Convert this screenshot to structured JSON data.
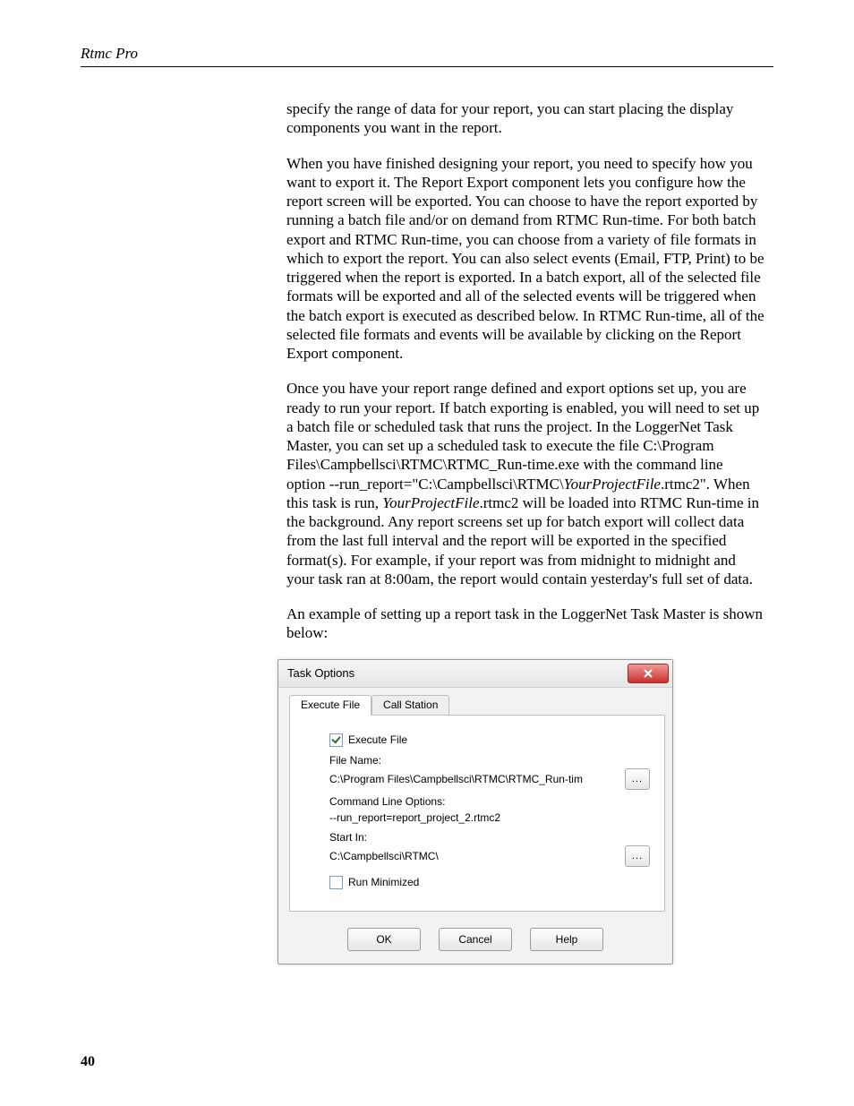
{
  "header": {
    "title": "Rtmc Pro"
  },
  "page_number": "40",
  "body": {
    "p1": "specify the range of data for your report, you can start placing the display components you want in the report.",
    "p2": "When you have finished designing your report, you need to specify how you want to export it. The Report Export component lets you configure how the report screen will be exported. You can choose to have the report exported by running a batch file and/or on demand from RTMC Run-time. For both batch export and RTMC Run-time, you can choose from a variety of file formats in which to export the report.  You can also select events (Email, FTP, Print) to be triggered when the report is exported. In a batch export, all of the selected file formats will be exported and all of the selected events will be triggered when the batch export is executed as described below.  In RTMC Run-time, all of the selected file formats and events will be available by clicking on the Report Export component.",
    "p3_a": "Once you have your report range defined and export options set up, you are ready to run your report. If batch exporting is enabled, you will need to set up a batch file or scheduled task that runs the project. In the LoggerNet Task Master, you can set up a scheduled task to execute the file C:\\Program Files\\Campbellsci\\RTMC\\RTMC_Run-time.exe with the command line option --run_report=\"C:\\Campbellsci\\RTMC\\",
    "p3_it1": "YourProjectFile",
    "p3_b": ".rtmc2\". When this task is run, ",
    "p3_it2": "YourProjectFile",
    "p3_c": ".rtmc2 will be loaded into RTMC Run-time in the background.  Any report screens set up for batch export will collect data from the last full interval and the report will be exported in the specified format(s). For example, if your report was from midnight to midnight and your task ran at 8:00am, the report would contain yesterday's full set of data.",
    "p4": "An example of setting up a report task in the LoggerNet Task Master is shown below:"
  },
  "dialog": {
    "title": "Task Options",
    "tabs": {
      "active": "Execute File",
      "inactive": "Call Station"
    },
    "execute_file_checkbox": "Execute File",
    "file_name_label": "File Name:",
    "file_name_value": "C:\\Program Files\\Campbellsci\\RTMC\\RTMC_Run-tim",
    "cmd_label": "Command Line Options:",
    "cmd_value": "--run_report=report_project_2.rtmc2",
    "startin_label": "Start In:",
    "startin_value": "C:\\Campbellsci\\RTMC\\",
    "run_min_label": "Run Minimized",
    "browse": "...",
    "buttons": {
      "ok": "OK",
      "cancel": "Cancel",
      "help": "Help"
    }
  }
}
